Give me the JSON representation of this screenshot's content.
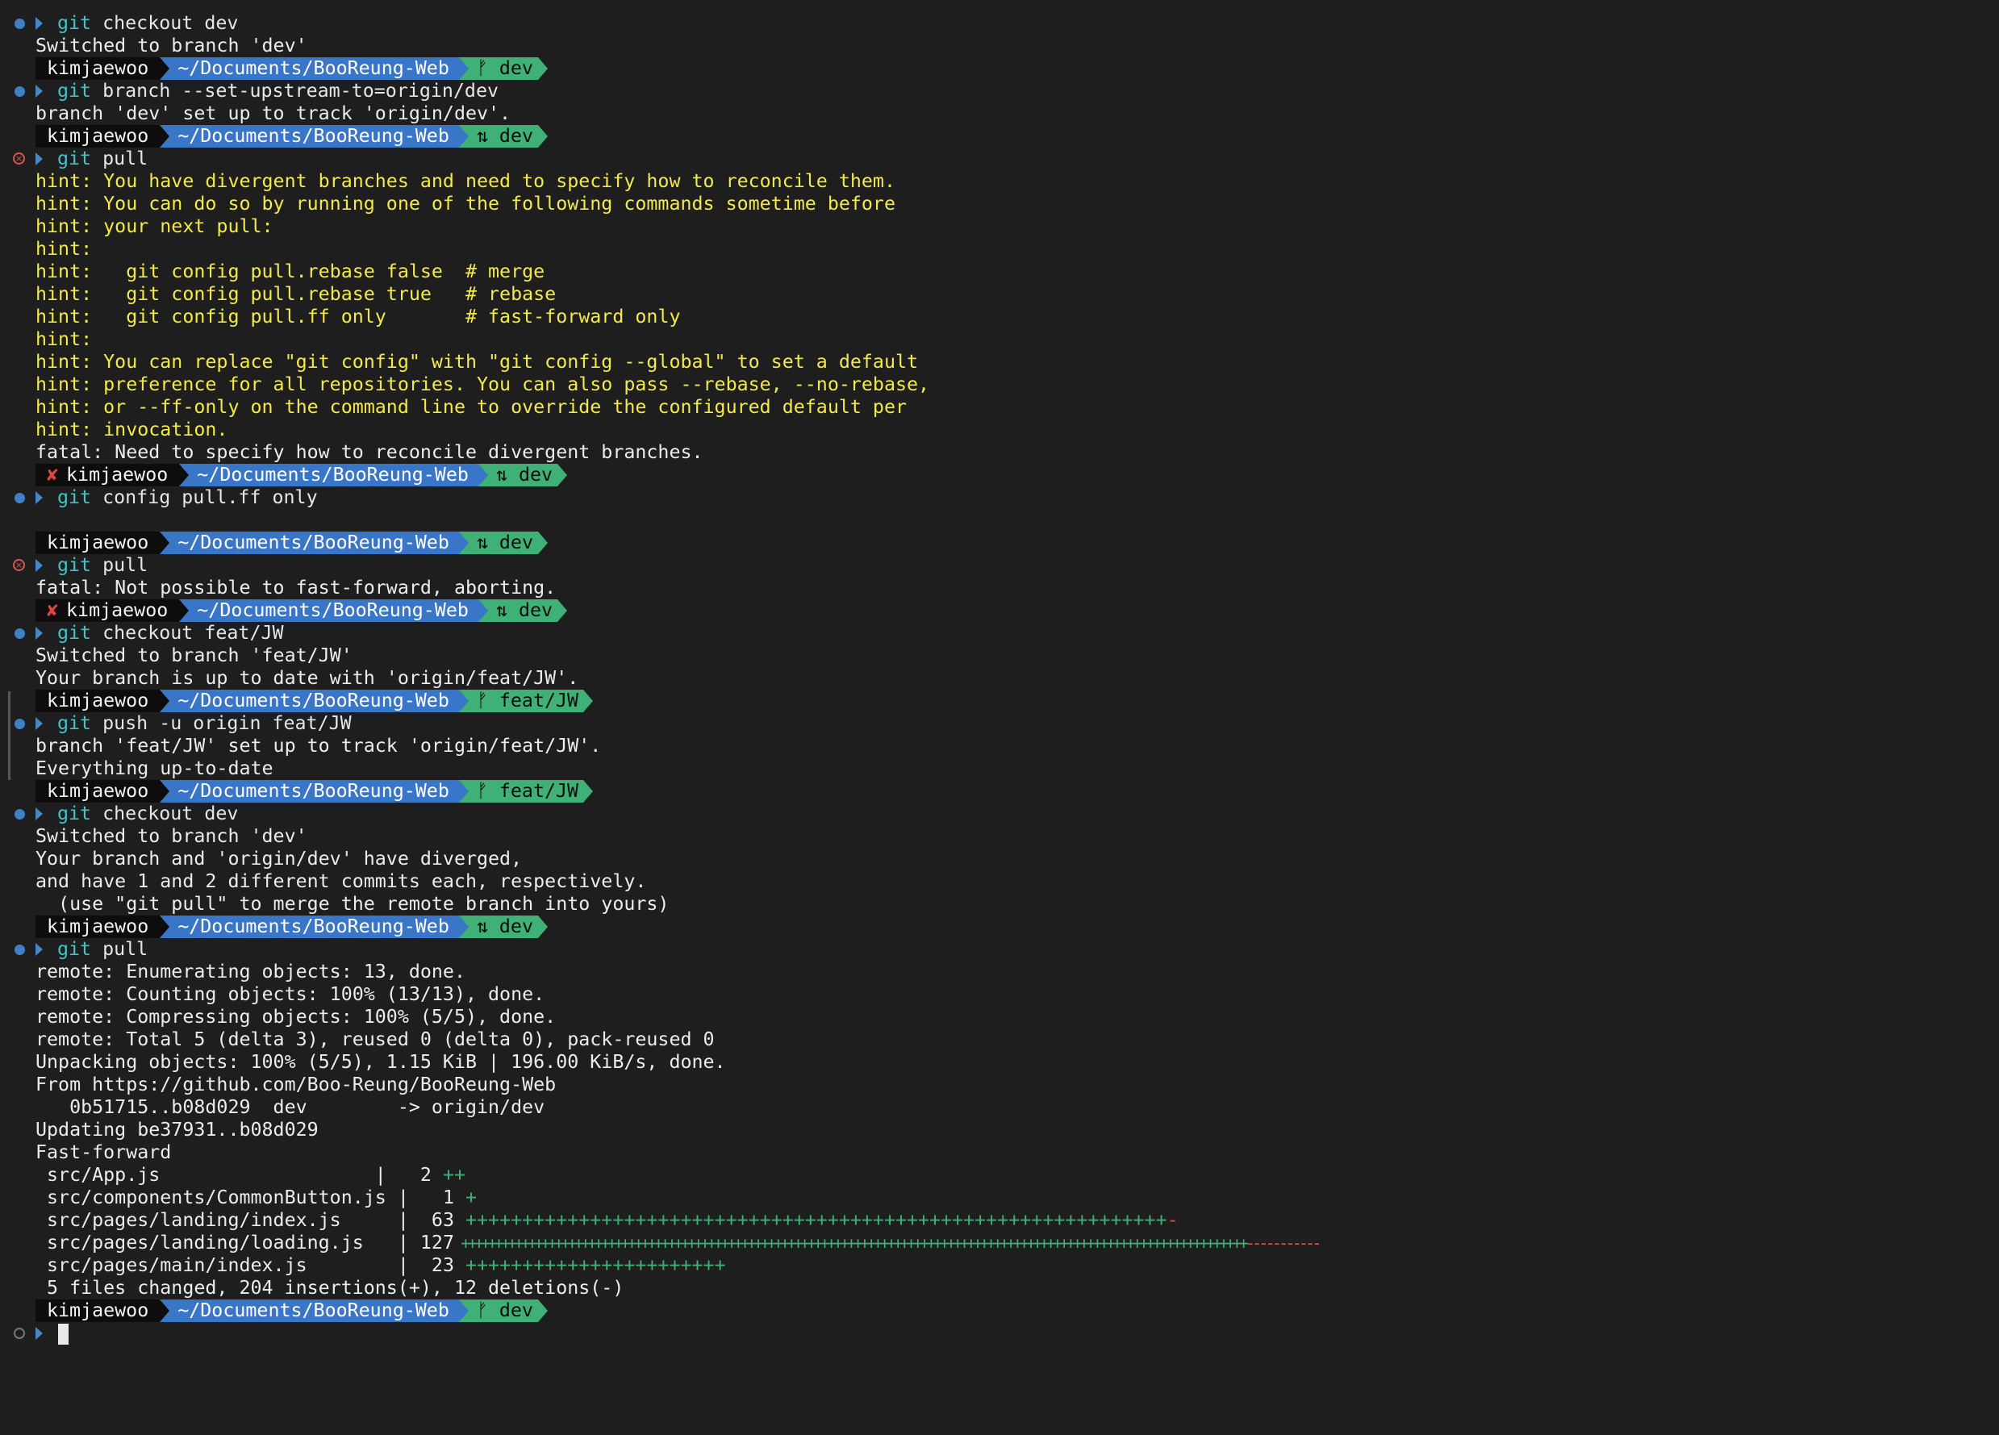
{
  "prompt": {
    "user": "kimjaewoo",
    "path": "~/Documents/BooReung-Web",
    "error_mark": "✘",
    "branch_dev_clean": "ᚠ dev",
    "branch_dev_diverged": "⇅ dev",
    "branch_feat": "ᚠ feat/JW"
  },
  "colors": {
    "background": "#1e1e1e",
    "prompt_user_bg": "#0d0d0d",
    "prompt_path_bg": "#3a76c8",
    "prompt_branch_bg": "#3fb176",
    "hint_text": "#f3e94b",
    "git_keyword": "#46c2c7",
    "insertion": "#3fb176",
    "deletion": "#d9534f"
  },
  "commands": {
    "c1": {
      "git": "git",
      "args": " checkout dev"
    },
    "c2": {
      "git": "git",
      "args": " branch --set-upstream-to=origin/dev"
    },
    "c3": {
      "git": "git",
      "args": " pull"
    },
    "c4": {
      "git": "git",
      "args": " config pull.ff only"
    },
    "c5": {
      "git": "git",
      "args": " pull"
    },
    "c6": {
      "git": "git",
      "args": " checkout feat/JW"
    },
    "c7": {
      "git": "git",
      "args": " push -u origin feat/JW"
    },
    "c8": {
      "git": "git",
      "args": " checkout dev"
    },
    "c9": {
      "git": "git",
      "args": " pull"
    }
  },
  "output": {
    "o1": "Switched to branch 'dev'",
    "o2": "branch 'dev' set up to track 'origin/dev'.",
    "h1": "hint: You have divergent branches and need to specify how to reconcile them.",
    "h2": "hint: You can do so by running one of the following commands sometime before",
    "h3": "hint: your next pull:",
    "h4": "hint:",
    "h5": "hint:   git config pull.rebase false  # merge",
    "h6": "hint:   git config pull.rebase true   # rebase",
    "h7": "hint:   git config pull.ff only       # fast-forward only",
    "h8": "hint:",
    "h9": "hint: You can replace \"git config\" with \"git config --global\" to set a default",
    "h10": "hint: preference for all repositories. You can also pass --rebase, --no-rebase,",
    "h11": "hint: or --ff-only on the command line to override the configured default per",
    "h12": "hint: invocation.",
    "f1": "fatal: Need to specify how to reconcile divergent branches.",
    "f2": "fatal: Not possible to fast-forward, aborting.",
    "o3": "Switched to branch 'feat/JW'",
    "o4": "Your branch is up to date with 'origin/feat/JW'.",
    "o5": "branch 'feat/JW' set up to track 'origin/feat/JW'.",
    "o6": "Everything up-to-date",
    "o7": "Switched to branch 'dev'",
    "o8": "Your branch and 'origin/dev' have diverged,",
    "o9": "and have 1 and 2 different commits each, respectively.",
    "o10": "  (use \"git pull\" to merge the remote branch into yours)",
    "r1": "remote: Enumerating objects: 13, done.",
    "r2": "remote: Counting objects: 100% (13/13), done.",
    "r3": "remote: Compressing objects: 100% (5/5), done.",
    "r4": "remote: Total 5 (delta 3), reused 0 (delta 0), pack-reused 0",
    "r5": "Unpacking objects: 100% (5/5), 1.15 KiB | 196.00 KiB/s, done.",
    "r6": "From https://github.com/Boo-Reung/BooReung-Web",
    "r7": "   0b51715..b08d029  dev        -> origin/dev",
    "r8": "Updating be37931..b08d029",
    "r9": "Fast-forward",
    "summary": " 5 files changed, 204 insertions(+), 12 deletions(-)"
  },
  "diffstat": [
    {
      "file": " src/App.js                   | ",
      "count": "  2",
      "plus": " ++",
      "minus": ""
    },
    {
      "file": " src/components/CommonButton.js | ",
      "count": "  1",
      "plus": " +",
      "minus": ""
    },
    {
      "file": " src/pages/landing/index.js     | ",
      "count": " 63",
      "plus": " ++++++++++++++++++++++++++++++++++++++++++++++++++++++++++++++",
      "minus": "-"
    },
    {
      "file": " src/pages/landing/loading.js   | ",
      "count": "127",
      "plus": " ++++++++++++++++++++++++++++++++++++++++++++++++++++++++++++++++++++++++++++++++++++++++++++++++++++++++++++++++++++++",
      "minus": "-----------"
    },
    {
      "file": " src/pages/main/index.js        | ",
      "count": " 23",
      "plus": " +++++++++++++++++++++++",
      "minus": ""
    }
  ]
}
